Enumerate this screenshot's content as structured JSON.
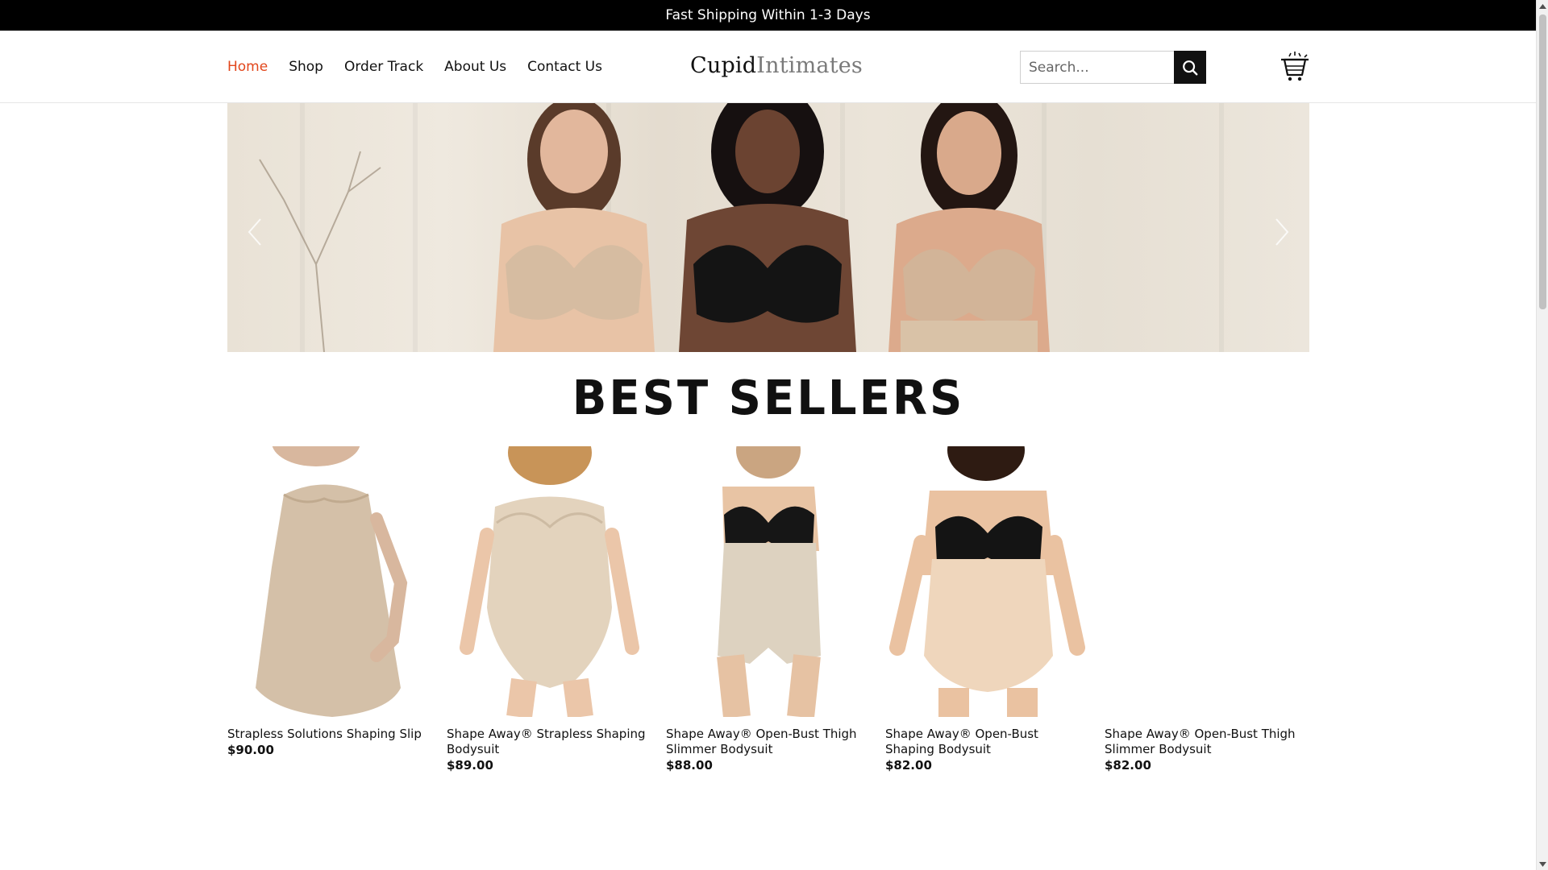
{
  "announcement": "Fast Shipping Within 1-3 Days",
  "nav": {
    "items": [
      {
        "label": "Home",
        "active": true
      },
      {
        "label": "Shop",
        "active": false
      },
      {
        "label": "Order Track",
        "active": false
      },
      {
        "label": "About Us",
        "active": false
      },
      {
        "label": "Contact Us",
        "active": false
      }
    ]
  },
  "logo": {
    "part1": "Cupid",
    "part2": "Intimates"
  },
  "search": {
    "placeholder": "Search...",
    "icon": "search-icon"
  },
  "cart": {
    "icon": "cart-icon"
  },
  "hero": {
    "prev_icon": "chevron-left-icon",
    "next_icon": "chevron-right-icon"
  },
  "section_title": "BEST SELLERS",
  "products": [
    {
      "name": "Strapless Solutions Shaping Slip",
      "price": "$90.00"
    },
    {
      "name": "Shape Away® Strapless Shaping Bodysuit",
      "price": "$89.00"
    },
    {
      "name": "Shape Away® Open-Bust Thigh Slimmer Bodysuit",
      "price": "$88.00"
    },
    {
      "name": "Shape Away® Open-Bust Shaping Bodysuit",
      "price": "$82.00"
    },
    {
      "name": "Shape Away® Open-Bust Thigh Slimmer Bodysuit",
      "price": "$82.00"
    }
  ],
  "colors": {
    "accent": "#e2461b",
    "topbar": "#000000",
    "nude": "#d9c6ad",
    "black": "#141414"
  }
}
